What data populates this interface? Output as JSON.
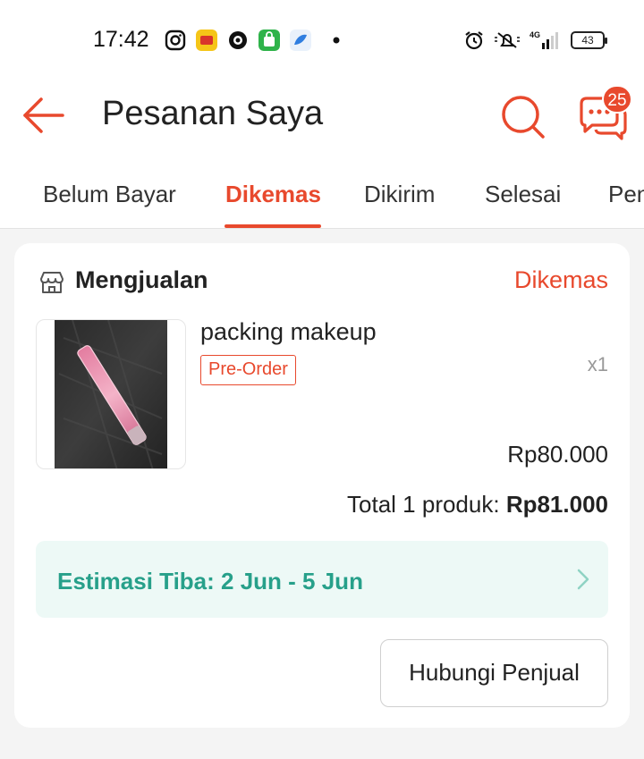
{
  "status_bar": {
    "time": "17:42",
    "battery": "43",
    "app_icons": [
      "instagram-icon",
      "dana-icon",
      "ojek-icon",
      "bag-app-icon",
      "bird-app-icon"
    ],
    "right_icons": [
      "alarm-icon",
      "mute-icon",
      "signal-4g-icon",
      "battery-icon"
    ]
  },
  "header": {
    "title": "Pesanan Saya",
    "chat_badge": "25"
  },
  "tabs": [
    {
      "label": "Belum Bayar"
    },
    {
      "label": "Dikemas"
    },
    {
      "label": "Dikirim"
    },
    {
      "label": "Selesai"
    },
    {
      "label": "Pengembalian"
    }
  ],
  "order": {
    "store_name": "Mengjualan",
    "status": "Dikemas",
    "product": {
      "name": "packing makeup",
      "badge": "Pre-Order",
      "quantity": "x1",
      "price": "Rp80.000"
    },
    "total_label": "Total 1 produk: ",
    "total_amount": "Rp81.000",
    "eta": "Estimasi Tiba: 2 Jun - 5 Jun",
    "contact_button": "Hubungi Penjual"
  },
  "colors": {
    "accent": "#e8492d",
    "eta_text": "#27a08a",
    "eta_bg": "#edf9f6"
  }
}
